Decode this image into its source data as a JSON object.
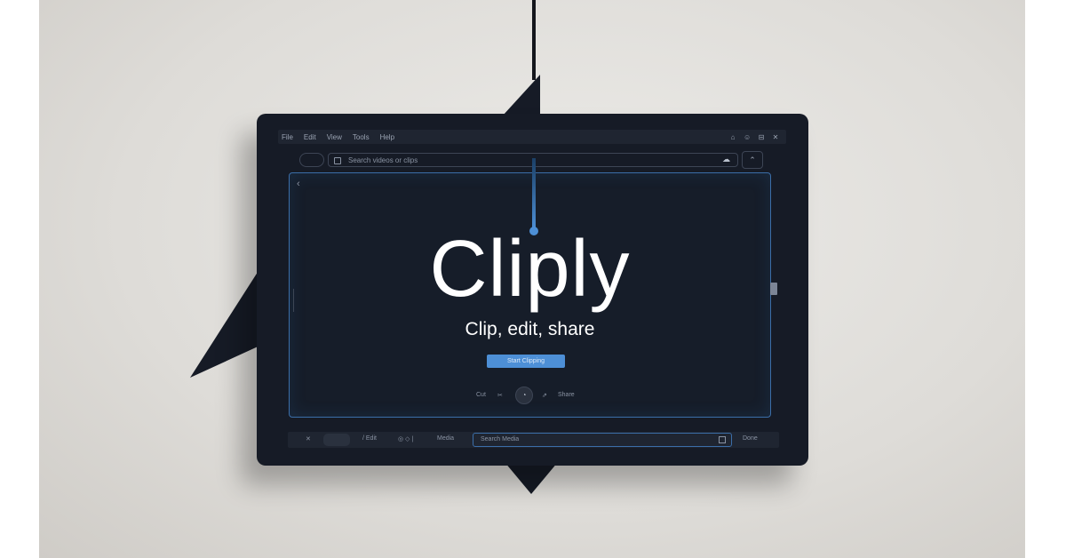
{
  "app": {
    "brand": "Cliply",
    "tagline": "Clip, edit, share"
  },
  "menubar": {
    "items": [
      "File",
      "Edit",
      "View",
      "Tools",
      "Help"
    ],
    "controls": [
      "⌂",
      "☺",
      "⊟",
      "✕"
    ]
  },
  "toolbar": {
    "address_text": "Search videos or clips",
    "cloud_icon": "☁",
    "right_icon": "⌃"
  },
  "canvas": {
    "back_icon": "‹",
    "cta_label": "Start Clipping",
    "controls": {
      "left_label": "Cut",
      "mid_left_label": "✂",
      "knob_label": "◔",
      "mid_right_label": "⇗",
      "right_label": "Share"
    }
  },
  "bottombar": {
    "left_icon": "✕",
    "edit_label": "/ Edit",
    "tools_label": "◎ ◇ |",
    "media_label": "Media",
    "field_text": "Search Media",
    "right_label": "Done"
  },
  "colors": {
    "accent": "#4d8fd6",
    "device": "#161b26",
    "wall": "#dedcd8"
  }
}
